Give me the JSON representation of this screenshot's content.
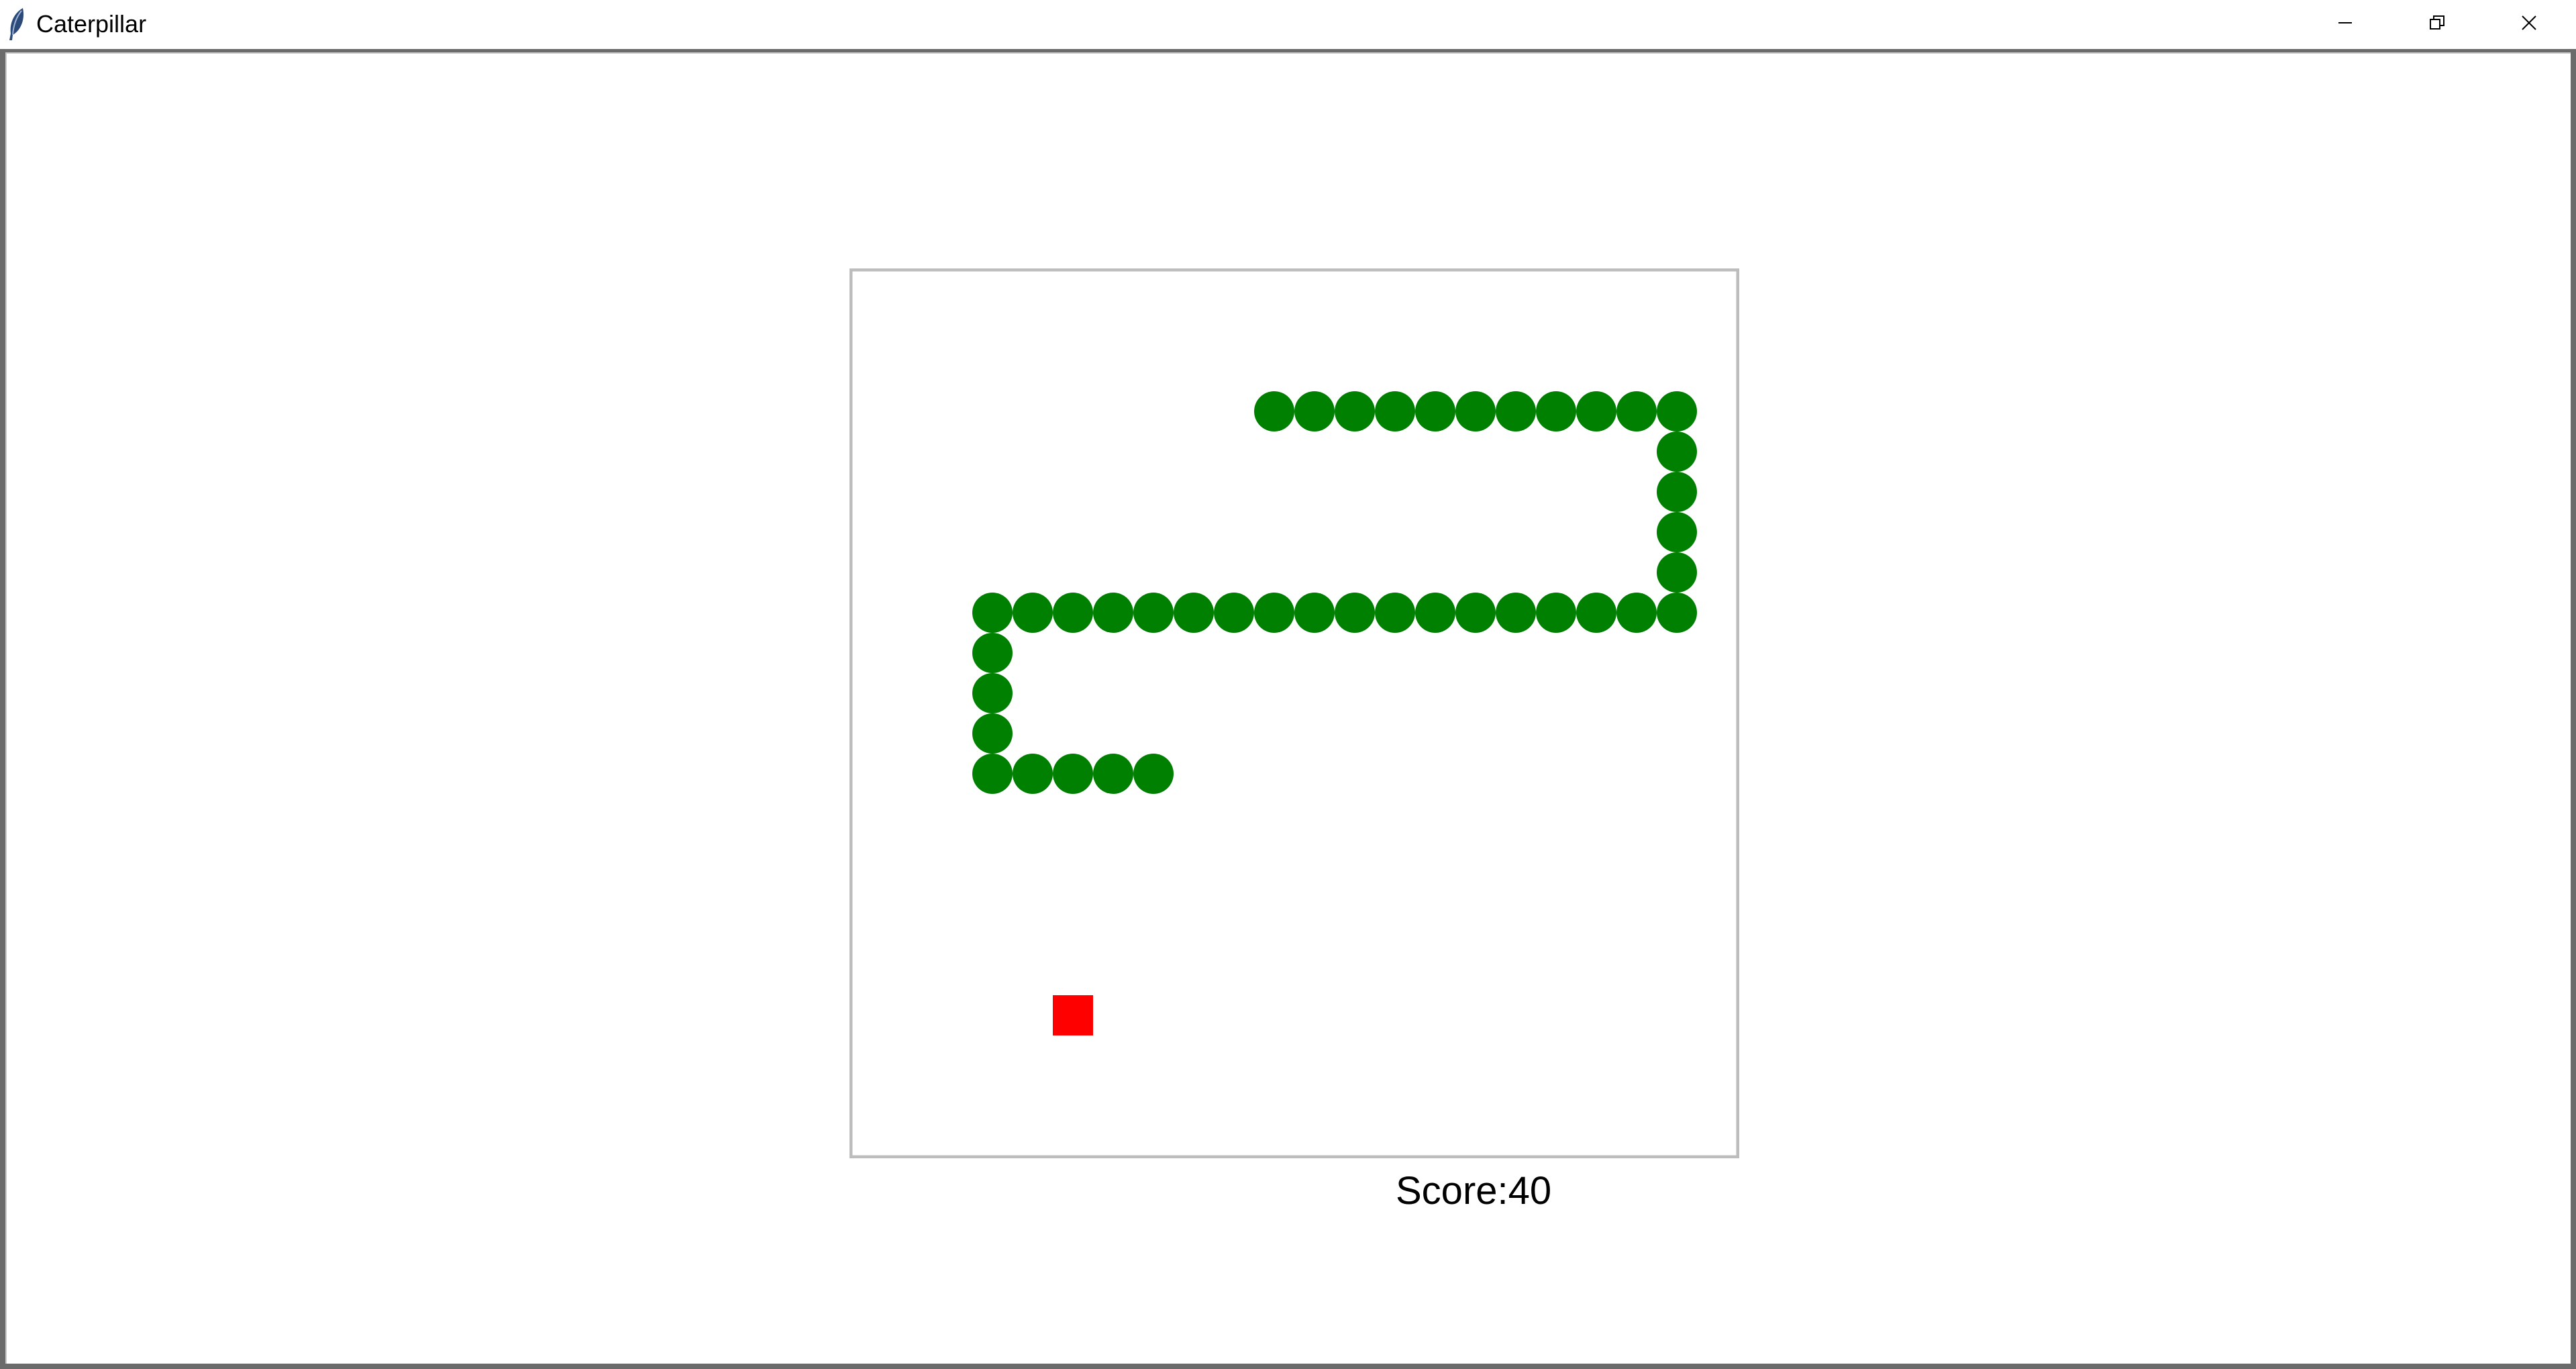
{
  "window": {
    "title": "Caterpillar",
    "icon": "feather-icon",
    "controls": [
      "minimize-icon",
      "restore-icon",
      "close-icon"
    ]
  },
  "game": {
    "grid": {
      "columns": 22,
      "rows": 22
    },
    "colors": {
      "board_background": "#ffffff",
      "board_border": "#bdbdbd",
      "caterpillar": "#008000",
      "food": "#ff0000"
    },
    "caterpillar_segments": [
      [
        10,
        3
      ],
      [
        11,
        3
      ],
      [
        12,
        3
      ],
      [
        13,
        3
      ],
      [
        14,
        3
      ],
      [
        15,
        3
      ],
      [
        16,
        3
      ],
      [
        17,
        3
      ],
      [
        18,
        3
      ],
      [
        19,
        3
      ],
      [
        20,
        3
      ],
      [
        20,
        4
      ],
      [
        20,
        5
      ],
      [
        20,
        6
      ],
      [
        20,
        7
      ],
      [
        20,
        8
      ],
      [
        19,
        8
      ],
      [
        18,
        8
      ],
      [
        17,
        8
      ],
      [
        16,
        8
      ],
      [
        15,
        8
      ],
      [
        14,
        8
      ],
      [
        13,
        8
      ],
      [
        12,
        8
      ],
      [
        11,
        8
      ],
      [
        10,
        8
      ],
      [
        9,
        8
      ],
      [
        8,
        8
      ],
      [
        7,
        8
      ],
      [
        6,
        8
      ],
      [
        5,
        8
      ],
      [
        4,
        8
      ],
      [
        3,
        8
      ],
      [
        3,
        9
      ],
      [
        3,
        10
      ],
      [
        3,
        11
      ],
      [
        3,
        12
      ],
      [
        4,
        12
      ],
      [
        5,
        12
      ],
      [
        6,
        12
      ],
      [
        7,
        12
      ]
    ],
    "food": [
      5,
      18
    ]
  },
  "score": {
    "text": "Score:40"
  }
}
